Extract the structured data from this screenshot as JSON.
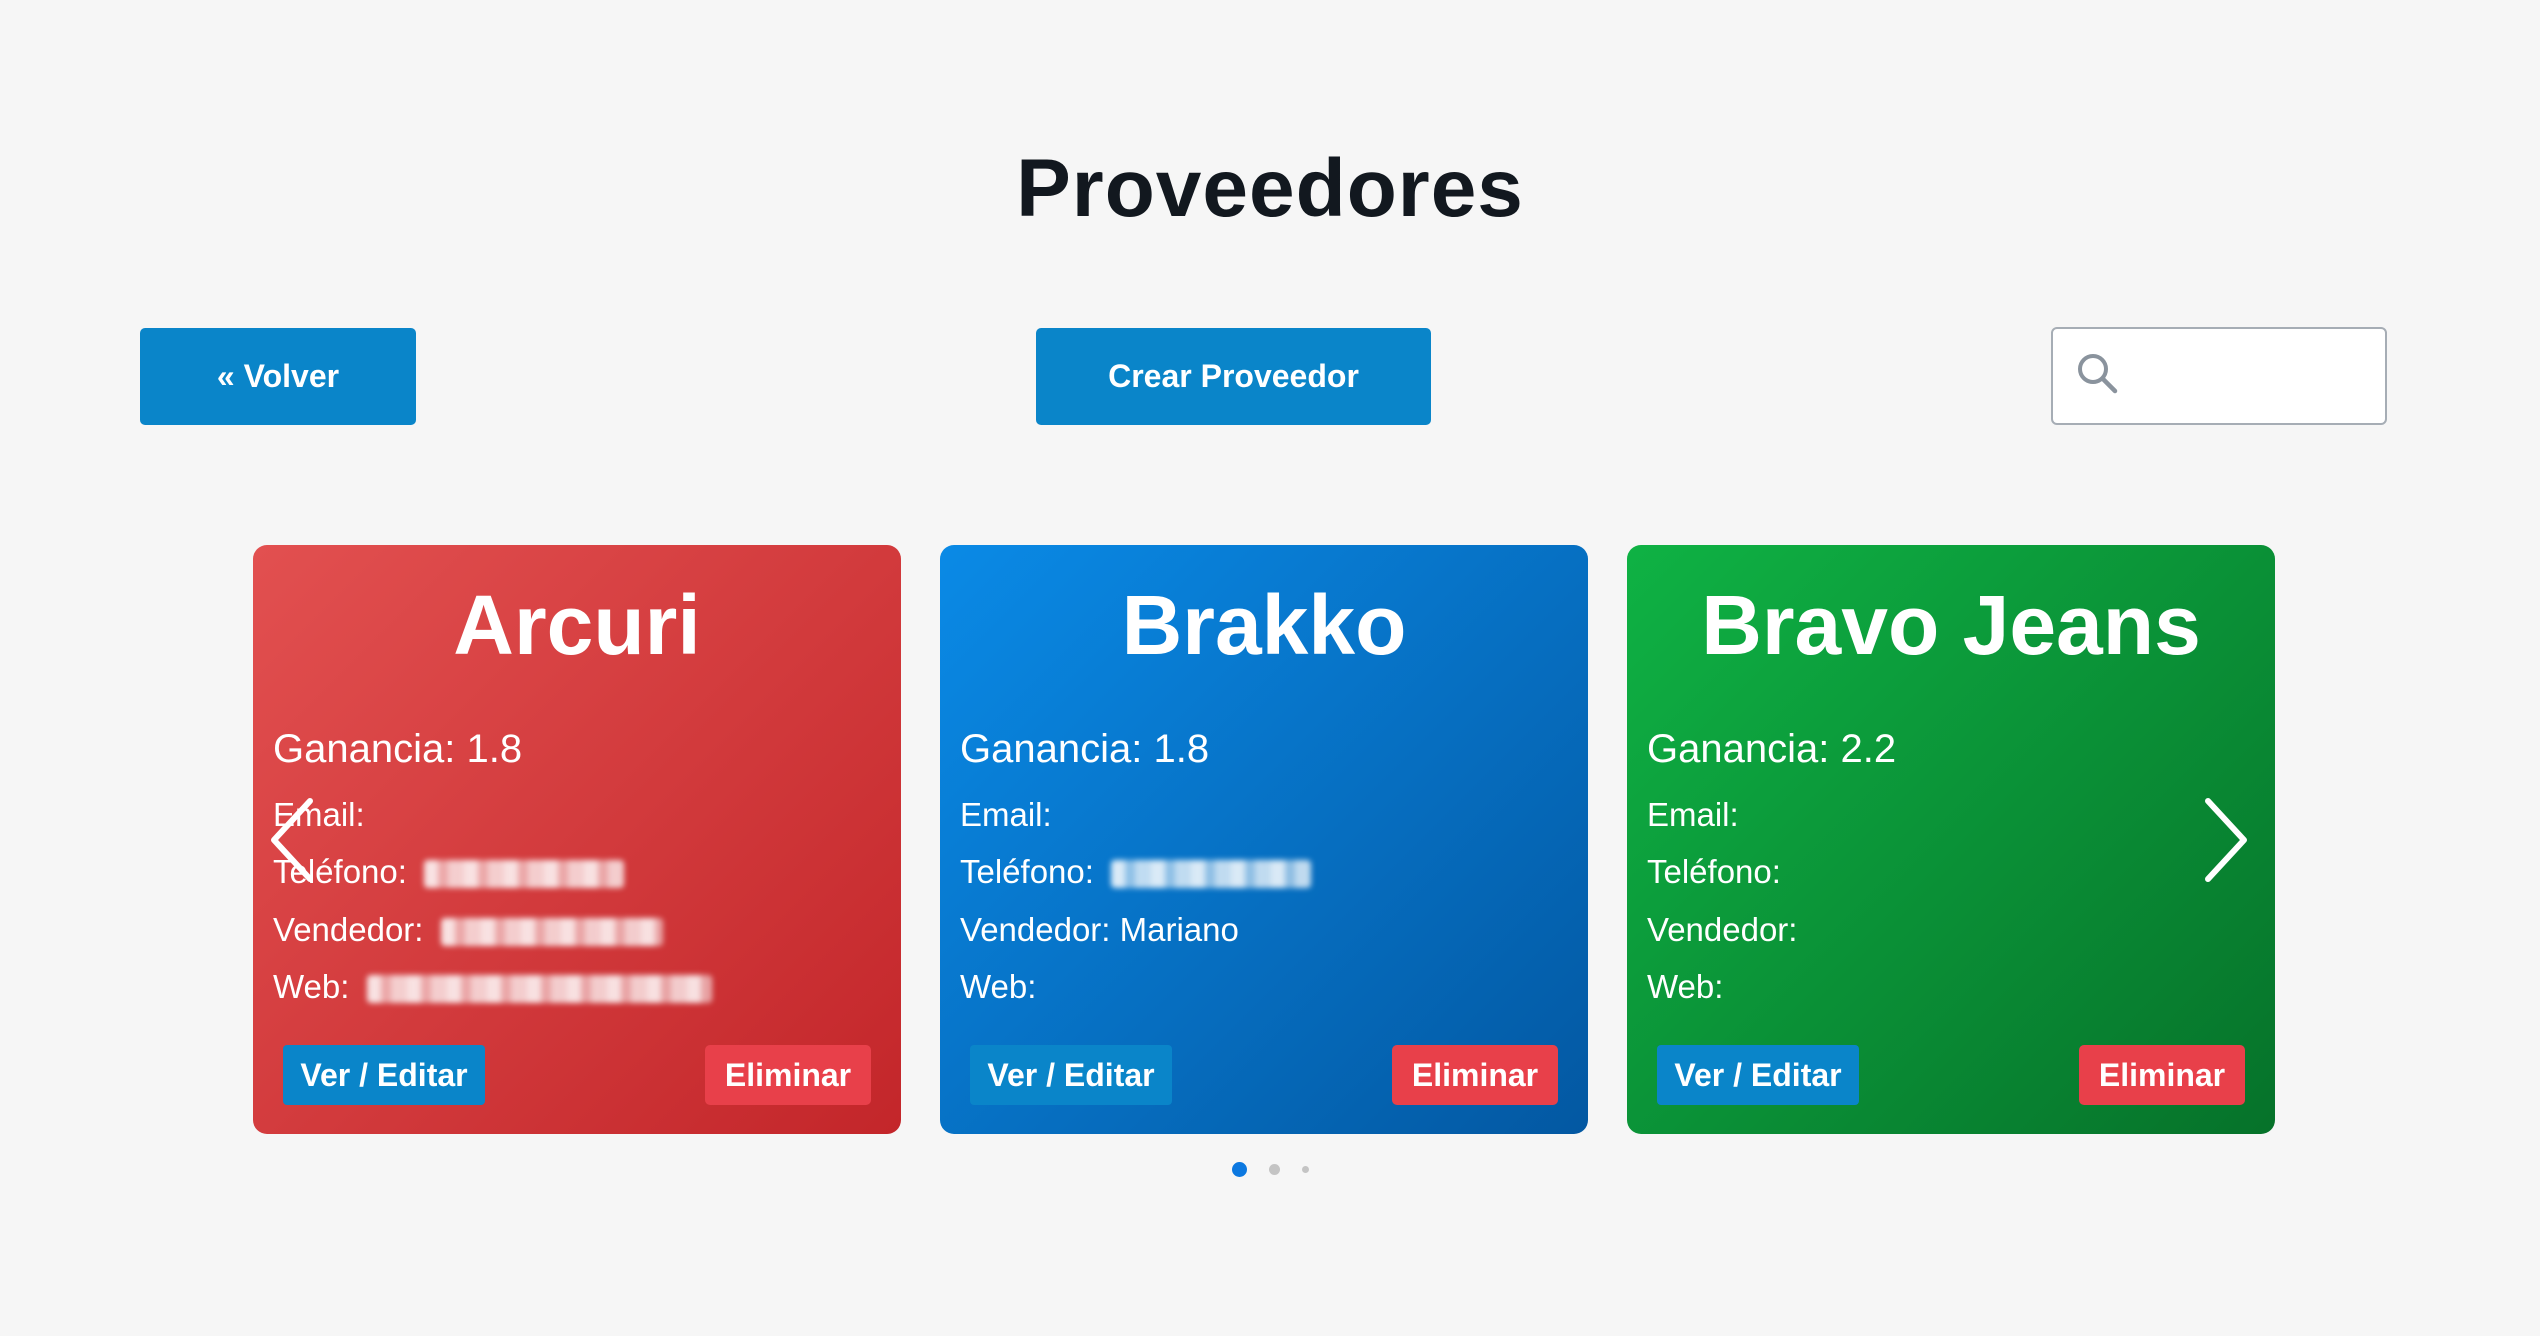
{
  "page": {
    "title": "Proveedores"
  },
  "toolbar": {
    "back_label": "« Volver",
    "create_label": "Crear Proveedor",
    "search_placeholder": "",
    "search_value": ""
  },
  "labels": {
    "gain": "Ganancia:",
    "email": "Email:",
    "phone": "Teléfono:",
    "seller": "Vendedor:",
    "web": "Web:",
    "edit": "Ver / Editar",
    "delete": "Eliminar"
  },
  "cards": [
    {
      "name": "Arcuri",
      "gain": "1.8",
      "email": "",
      "phone": "",
      "seller": "",
      "web": "",
      "phone_redacted": true,
      "seller_redacted": true,
      "web_redacted": true,
      "color": "#d13a3d"
    },
    {
      "name": "Brakko",
      "gain": "1.8",
      "email": "",
      "phone": "",
      "seller": "Mariano",
      "web": "",
      "phone_redacted": true,
      "color": "#0674c8"
    },
    {
      "name": "Bravo Jeans",
      "gain": "2.2",
      "email": "",
      "phone": "",
      "seller": "",
      "web": "",
      "color": "#0a9238"
    }
  ],
  "carousel": {
    "active_page": 1,
    "page_count": 3
  },
  "icons": {
    "search": "search-icon",
    "prev": "chevron-left-icon",
    "next": "chevron-right-icon"
  },
  "colors": {
    "primary": "#0a85c9",
    "danger": "#e8404a",
    "background": "#f6f6f6",
    "title": "#12181f",
    "active_dot": "#0c78e0"
  }
}
